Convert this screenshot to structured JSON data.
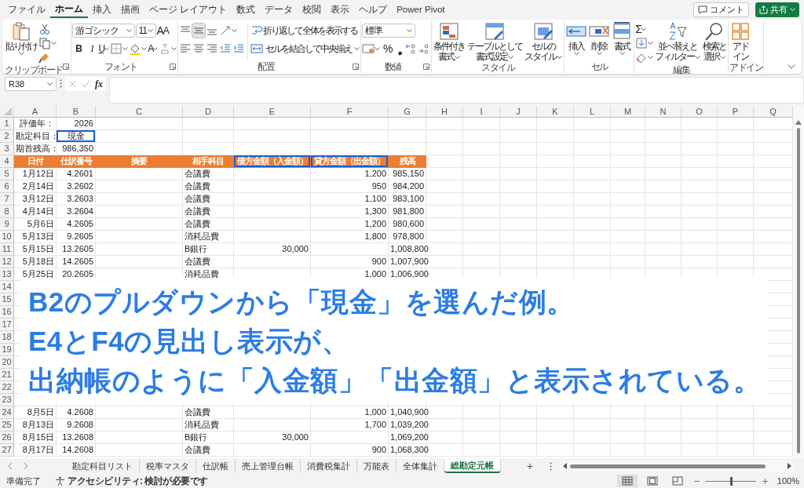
{
  "menu_tabs": [
    {
      "label": "ファイル",
      "selected": false
    },
    {
      "label": "ホーム",
      "selected": true
    },
    {
      "label": "挿入",
      "selected": false
    },
    {
      "label": "描画",
      "selected": false
    },
    {
      "label": "ページ レイアウト",
      "selected": false
    },
    {
      "label": "数式",
      "selected": false
    },
    {
      "label": "データ",
      "selected": false
    },
    {
      "label": "校閲",
      "selected": false
    },
    {
      "label": "表示",
      "selected": false
    },
    {
      "label": "ヘルプ",
      "selected": false
    },
    {
      "label": "Power Pivot",
      "selected": false
    }
  ],
  "top_buttons": {
    "comment": "コメント",
    "share": "共有"
  },
  "ribbon": [
    {
      "kind": "clipboard",
      "label": "クリップボード",
      "launcher": true,
      "paste": "貼り付け"
    },
    {
      "kind": "font",
      "label": "フォント",
      "launcher": true,
      "font_name": "游ゴシック",
      "font_size": "11",
      "grow": "A",
      "shrink": "A",
      "bold": "B",
      "italic": "I",
      "underline": "U",
      "font_color": "A"
    },
    {
      "kind": "alignment",
      "label": "配置",
      "launcher": true,
      "vertical_buttons": [
        {
          "selected": false
        },
        {
          "selected": true
        },
        {
          "selected": false
        }
      ],
      "wrap": "折り返して全体を表示する",
      "merge": "セルを結合して中央揃え"
    },
    {
      "kind": "number",
      "label": "数値",
      "launcher": true,
      "format": "標準",
      "percent": "%",
      "comma": "❟"
    },
    {
      "kind": "styles",
      "label": "スタイル",
      "buttons": [
        {
          "lines": [
            "条件付き",
            "書式"
          ]
        },
        {
          "lines": [
            "テーブルとして",
            "書式設定"
          ]
        },
        {
          "lines": [
            "セルの",
            "スタイル"
          ]
        }
      ]
    },
    {
      "kind": "cells",
      "label": "セル",
      "buttons": [
        {
          "lines": [
            "挿入"
          ]
        },
        {
          "lines": [
            "削除"
          ]
        },
        {
          "lines": [
            "書式"
          ]
        }
      ]
    },
    {
      "kind": "editing",
      "label": "編集",
      "sum": "Σ",
      "buttons": [
        {
          "lines": [
            "並べ替えと",
            "フィルター"
          ]
        },
        {
          "lines": [
            "検索と",
            "選択"
          ]
        }
      ]
    },
    {
      "kind": "addins",
      "label": "アドイン",
      "buttons": [
        {
          "lines": [
            "アド",
            "イン"
          ]
        }
      ]
    }
  ],
  "formula_bar": {
    "name_box": "R38",
    "fx": "fx"
  },
  "columns": [
    "A",
    "B",
    "C",
    "D",
    "E",
    "F",
    "G",
    "H",
    "I",
    "J",
    "K",
    "L",
    "M",
    "N",
    "O",
    "P",
    "Q"
  ],
  "rows": [
    {
      "num": "1",
      "kind": "label",
      "cells": {
        "A": "評価年：",
        "B": "2026"
      }
    },
    {
      "num": "2",
      "kind": "label",
      "cells": {
        "A": "勘定科目：",
        "B": "現金"
      },
      "outlined": {
        "B": true
      }
    },
    {
      "num": "3",
      "kind": "label",
      "cells": {
        "A": "期首残高：",
        "B": "986,350"
      }
    },
    {
      "num": "4",
      "kind": "header",
      "cells": {
        "A": "日付",
        "B": "仕訳番号",
        "C": "摘要",
        "D": "相手科目",
        "E": "借方金額（入金額）",
        "F": "貸方金額（出金額）",
        "G": "残高"
      },
      "outlined": {
        "E": true,
        "F": true
      }
    },
    {
      "num": "5",
      "kind": "data",
      "cells": {
        "A": "1月12日",
        "B": "4.2601",
        "D": "会議費",
        "F": "1,200",
        "G": "985,150"
      }
    },
    {
      "num": "6",
      "kind": "data",
      "cells": {
        "A": "2月14日",
        "B": "3.2602",
        "D": "会議費",
        "F": "950",
        "G": "984,200"
      }
    },
    {
      "num": "7",
      "kind": "data",
      "cells": {
        "A": "3月12日",
        "B": "3.2603",
        "D": "会議費",
        "F": "1,100",
        "G": "983,100"
      }
    },
    {
      "num": "8",
      "kind": "data",
      "cells": {
        "A": "4月14日",
        "B": "3.2604",
        "D": "会議費",
        "F": "1,300",
        "G": "981,800"
      }
    },
    {
      "num": "9",
      "kind": "data",
      "cells": {
        "A": "5月6日",
        "B": "4.2605",
        "D": "会議費",
        "F": "1,200",
        "G": "980,600"
      }
    },
    {
      "num": "10",
      "kind": "data",
      "cells": {
        "A": "5月13日",
        "B": "9.2605",
        "D": "消耗品費",
        "F": "1,800",
        "G": "978,800"
      }
    },
    {
      "num": "11",
      "kind": "data",
      "cells": {
        "A": "5月15日",
        "B": "13.2605",
        "D": "B銀行",
        "E": "30,000",
        "G": "1,008,800"
      }
    },
    {
      "num": "12",
      "kind": "data",
      "cells": {
        "A": "5月18日",
        "B": "14.2605",
        "D": "会議費",
        "F": "900",
        "G": "1,007,900"
      }
    },
    {
      "num": "13",
      "kind": "data",
      "cells": {
        "A": "5月25日",
        "B": "20.2605",
        "D": "消耗品費",
        "F": "1,000",
        "G": "1,006,900"
      }
    },
    {
      "num": "14",
      "kind": "data",
      "cells": {}
    },
    {
      "num": "15",
      "kind": "data",
      "cells": {}
    },
    {
      "num": "16",
      "kind": "data",
      "cells": {}
    },
    {
      "num": "17",
      "kind": "data",
      "cells": {}
    },
    {
      "num": "18",
      "kind": "data",
      "cells": {}
    },
    {
      "num": "19",
      "kind": "data",
      "cells": {}
    },
    {
      "num": "20",
      "kind": "data",
      "cells": {}
    },
    {
      "num": "21",
      "kind": "data",
      "cells": {}
    },
    {
      "num": "22",
      "kind": "data",
      "cells": {}
    },
    {
      "num": "23",
      "kind": "data",
      "cells": {}
    },
    {
      "num": "24",
      "kind": "data",
      "cells": {
        "A": "8月5日",
        "B": "4.2608",
        "D": "会議費",
        "F": "1,000",
        "G": "1,040,900"
      }
    },
    {
      "num": "25",
      "kind": "data",
      "cells": {
        "A": "8月13日",
        "B": "9.2608",
        "D": "消耗品費",
        "F": "1,700",
        "G": "1,039,200"
      }
    },
    {
      "num": "26",
      "kind": "data",
      "cells": {
        "A": "8月15日",
        "B": "13.2608",
        "D": "B銀行",
        "E": "30,000",
        "G": "1,069,200"
      }
    },
    {
      "num": "27",
      "kind": "data",
      "cells": {
        "A": "8月17日",
        "B": "14.2608",
        "D": "会議費",
        "F": "900",
        "G": "1,068,300"
      }
    }
  ],
  "annotation": {
    "lines": [
      "B2のプルダウンから「現金」を選んだ例。",
      "E4とF4の見出し表示が、",
      "出納帳のように「入金額」「出金額」と表示されている。"
    ]
  },
  "sheet_tabs": [
    {
      "label": "勘定科目リスト",
      "selected": false
    },
    {
      "label": "税率マスタ",
      "selected": false
    },
    {
      "label": "仕訳帳",
      "selected": false
    },
    {
      "label": "売上管理台帳",
      "selected": false
    },
    {
      "label": "消費税集計",
      "selected": false
    },
    {
      "label": "万能表",
      "selected": false
    },
    {
      "label": "全体集計",
      "selected": false
    },
    {
      "label": "総勘定元帳",
      "selected": true
    }
  ],
  "add_sheet": "+",
  "status_bar": {
    "ready": "準備完了",
    "accessibility": "アクセシビリティ: 検討が必要です",
    "views": [
      {
        "selected": true
      },
      {
        "selected": false
      },
      {
        "selected": false
      }
    ],
    "zoom": {
      "level": 0.5,
      "text": "100%"
    }
  }
}
